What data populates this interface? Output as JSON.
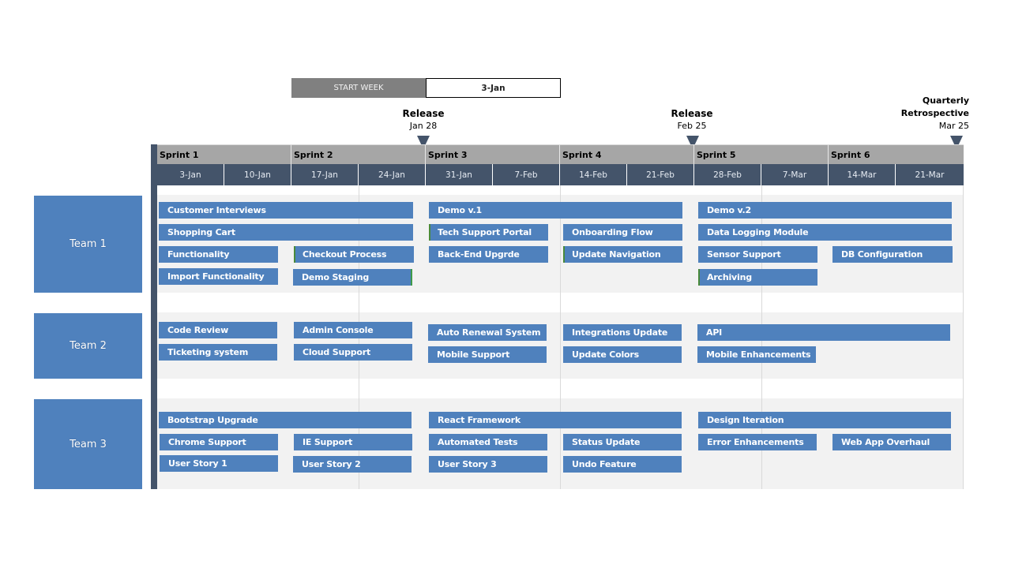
{
  "start_week": {
    "label": "START WEEK",
    "value": "3-Jan"
  },
  "milestones": [
    {
      "title": "Release",
      "date": "Jan 28"
    },
    {
      "title": "Release",
      "date": "Feb 25"
    },
    {
      "title_line1": "Quarterly",
      "title_line2": "Retrospective",
      "date": "Mar 25"
    }
  ],
  "sprints": [
    "Sprint 1",
    "Sprint 2",
    "Sprint 3",
    "Sprint 4",
    "Sprint 5",
    "Sprint 6"
  ],
  "weeks": [
    "3-Jan",
    "10-Jan",
    "17-Jan",
    "24-Jan",
    "31-Jan",
    "7-Feb",
    "14-Feb",
    "21-Feb",
    "28-Feb",
    "7-Mar",
    "14-Mar",
    "21-Mar"
  ],
  "teams": [
    {
      "name": "Team 1"
    },
    {
      "name": "Team 2"
    },
    {
      "name": "Team 3"
    }
  ],
  "tasks": {
    "team1": [
      "Customer Interviews",
      "Shopping Cart",
      "Functionality",
      "Import Functionality",
      "Checkout Process",
      "Demo Staging",
      "Demo v.1",
      "Tech Support Portal",
      "Back-End Upgrde",
      "Onboarding Flow",
      "Update Navigation",
      "Demo v.2",
      "Data Logging Module",
      "Sensor Support",
      "Archiving",
      "DB Configuration"
    ],
    "team2": [
      "Code Review",
      "Ticketing system",
      "Admin Console",
      "Cloud Support",
      "Auto Renewal System",
      "Mobile Support",
      "Integrations Update",
      "Update Colors",
      "API",
      "Mobile Enhancements"
    ],
    "team3": [
      "Bootstrap Upgrade",
      "Chrome Support",
      "User Story 1",
      "IE Support",
      "User Story 2",
      "React Framework",
      "Automated Tests",
      "User Story 3",
      "Status Update",
      "Undo Feature",
      "Design Iteration",
      "Error Enhancements",
      "Web App Overhaul"
    ]
  },
  "colors": {
    "task": "#4f81bd",
    "header_dark": "#44546a",
    "sprint_header": "#a6a6a6",
    "band": "#f2f2f2"
  }
}
